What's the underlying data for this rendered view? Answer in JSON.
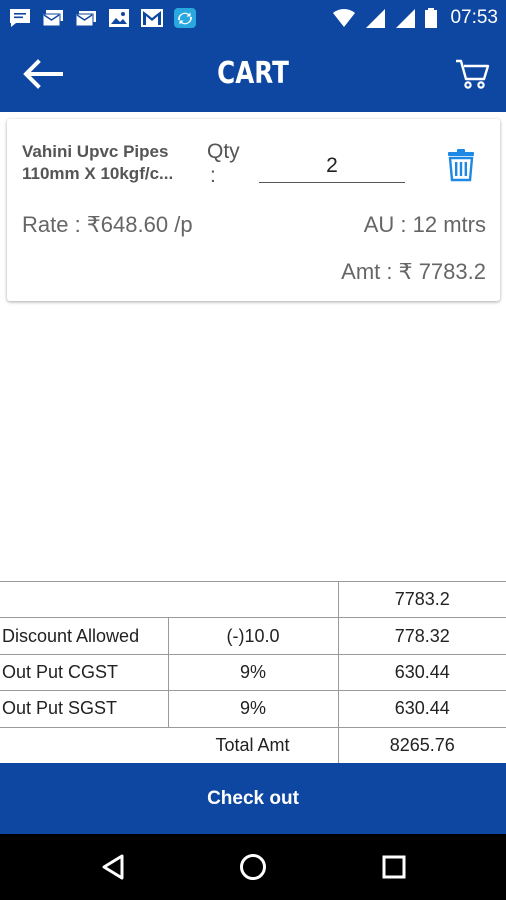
{
  "status_bar": {
    "time": "07:53",
    "notification_icons": [
      "message-icon",
      "stacked-mail-icon",
      "mail-icon",
      "image-icon",
      "gmail-icon",
      "sync-app-icon"
    ],
    "system_icons": [
      "wifi-icon",
      "signal-icon",
      "signal-icon",
      "battery-icon"
    ]
  },
  "app_bar": {
    "title": "CART",
    "back_icon": "arrow-left-icon",
    "cart_icon": "shopping-cart-icon"
  },
  "cart_items": [
    {
      "name_line1": "Vahini Upvc Pipes",
      "name_line2": "110mm X 10kgf/c...",
      "qty_label": "Qty",
      "qty_colon": ":",
      "qty_value": "2",
      "rate": "Rate : ₹648.60 /p",
      "au": "AU : 12 mtrs",
      "amount": "Amt : ₹ 7783.2",
      "delete_icon": "trash-icon"
    }
  ],
  "summary": {
    "subtotal": "7783.2",
    "discount": {
      "label": "Discount Allowed",
      "rate": "(-)10.0",
      "value": "778.32"
    },
    "cgst": {
      "label": "Out Put CGST",
      "rate": "9%",
      "value": "630.44"
    },
    "sgst": {
      "label": "Out Put SGST",
      "rate": "9%",
      "value": "630.44"
    },
    "total": {
      "label": "Total Amt",
      "value": "8265.76"
    }
  },
  "checkout": {
    "label": "Check out"
  },
  "nav_bar": {
    "icons": [
      "back-triangle-icon",
      "home-circle-icon",
      "recents-square-icon"
    ]
  },
  "colors": {
    "primary": "#0d47a1",
    "accent_icon": "#1e88e5",
    "divider": "#9a9a9a",
    "nav_bg": "#000000"
  }
}
